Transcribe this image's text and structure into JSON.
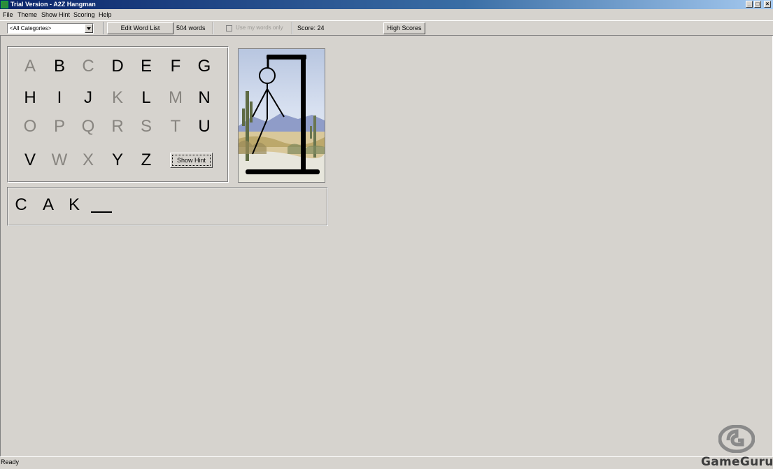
{
  "window": {
    "title": "Trial Version - A2Z Hangman",
    "controls": [
      "_",
      "×"
    ]
  },
  "menu": [
    "File",
    "Theme",
    "Show Hint",
    "Scoring",
    "Help"
  ],
  "toolbar": {
    "category": "<All Categories>",
    "edit_button": "Edit Word List",
    "word_count": "504 words",
    "use_my_words_label": "Use my words only",
    "use_my_words_checked": false,
    "score": "Score: 24",
    "high_scores_button": "High Scores"
  },
  "letters": [
    {
      "ch": "A",
      "used": true
    },
    {
      "ch": "B",
      "used": false
    },
    {
      "ch": "C",
      "used": true
    },
    {
      "ch": "D",
      "used": false
    },
    {
      "ch": "E",
      "used": false
    },
    {
      "ch": "F",
      "used": false
    },
    {
      "ch": "G",
      "used": false
    },
    {
      "ch": "H",
      "used": false
    },
    {
      "ch": "I",
      "used": false
    },
    {
      "ch": "J",
      "used": false
    },
    {
      "ch": "K",
      "used": true
    },
    {
      "ch": "L",
      "used": false
    },
    {
      "ch": "M",
      "used": true
    },
    {
      "ch": "N",
      "used": false
    },
    {
      "ch": "O",
      "used": true
    },
    {
      "ch": "P",
      "used": true
    },
    {
      "ch": "Q",
      "used": true
    },
    {
      "ch": "R",
      "used": true
    },
    {
      "ch": "S",
      "used": true
    },
    {
      "ch": "T",
      "used": true
    },
    {
      "ch": "U",
      "used": false
    },
    {
      "ch": "V",
      "used": false
    },
    {
      "ch": "W",
      "used": true
    },
    {
      "ch": "X",
      "used": true
    },
    {
      "ch": "Y",
      "used": false
    },
    {
      "ch": "Z",
      "used": false
    }
  ],
  "hint_button": "Show Hint",
  "word": [
    "C",
    "A",
    "K",
    ""
  ],
  "status": "Ready",
  "watermark": "GameGuru"
}
